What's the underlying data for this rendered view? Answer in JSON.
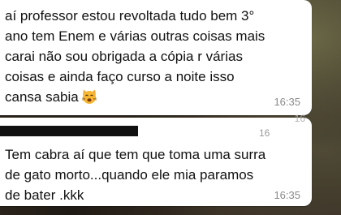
{
  "messages": [
    {
      "text": "aí professor estou revoltada tudo bem 3°\nano tem Enem e várias outras coisas mais\ncarai não sou obrigada a cópia r várias\ncoisas e ainda faço curso a noite isso\ncansa sabia",
      "emoji": "weary-cat-face-icon",
      "time": "16:35"
    },
    {
      "sender_partial_time": "16",
      "sender_partial_time_clipped": "16",
      "text": "Tem cabra aí que tem que toma uma surra\nde gato morto...quando ele mia paramos\nde bater .kkk",
      "time": "16:35"
    }
  ],
  "colors": {
    "bubble": "#ffffff",
    "text": "#111111",
    "timestamp": "#8a8a8a",
    "emoji_face": "#f7b733"
  }
}
